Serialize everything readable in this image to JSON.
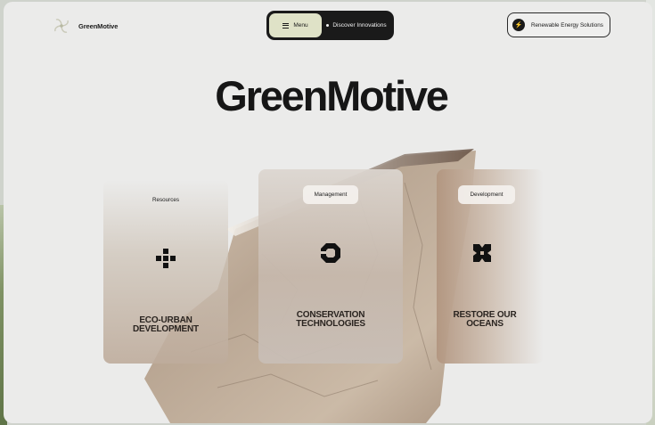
{
  "brand": {
    "name": "GreenMotive",
    "logo_icon": "pinwheel-logo-icon"
  },
  "nav": {
    "menu_label": "Menu",
    "discover_label": "Discover Innovations"
  },
  "cta": {
    "label": "Renewable Energy Solutions",
    "icon": "lightning-icon"
  },
  "hero": {
    "title": "GreenMotive"
  },
  "cards": [
    {
      "tag": "Resources",
      "title_line1": "ECO-URBAN",
      "title_line2": "DEVELOPMENT",
      "icon": "plus-diamond-icon"
    },
    {
      "tag": "Management",
      "title_line1": "CONSERVATION",
      "title_line2": "TECHNOLOGIES",
      "icon": "octagon-ring-icon"
    },
    {
      "tag": "Development",
      "title_line1": "RESTORE OUR",
      "title_line2": "OCEANS",
      "icon": "x-cross-icon"
    }
  ],
  "colors": {
    "background": "#ebebea",
    "dark": "#1a1a1a",
    "menu_accent": "#dfe2c7"
  }
}
